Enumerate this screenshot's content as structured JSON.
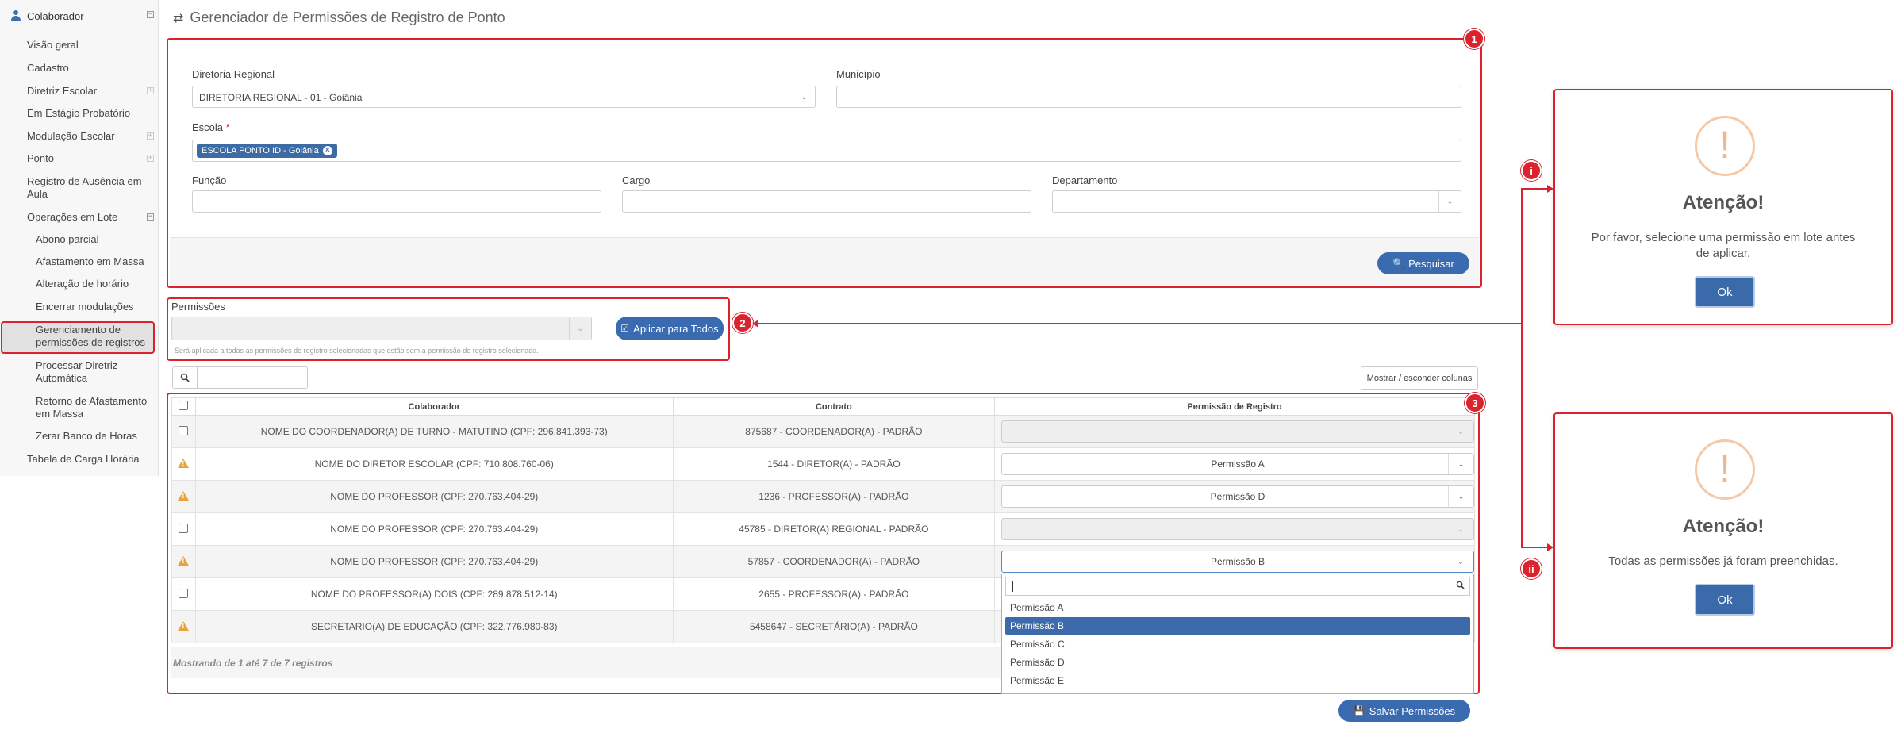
{
  "sidebar": {
    "header": "Colaborador",
    "items": [
      {
        "label": "Visão geral"
      },
      {
        "label": "Cadastro"
      },
      {
        "label": "Diretriz Escolar"
      },
      {
        "label": "Em Estágio Probatório"
      },
      {
        "label": "Modulação Escolar"
      },
      {
        "label": "Ponto"
      },
      {
        "label": "Registro de Ausência em Aula"
      },
      {
        "label": "Operações em Lote"
      }
    ],
    "subitems": [
      {
        "label": "Abono parcial"
      },
      {
        "label": "Afastamento em Massa"
      },
      {
        "label": "Alteração de horário"
      },
      {
        "label": "Encerrar modulações"
      },
      {
        "label": "Gerenciamento de permissões de registros"
      },
      {
        "label": "Processar Diretriz Automática"
      },
      {
        "label": "Retorno de Afastamento em Massa"
      },
      {
        "label": "Zerar Banco de Horas"
      }
    ],
    "last_item": "Tabela de Carga Horária"
  },
  "page": {
    "title": "Gerenciador de Permissões de Registro de Ponto"
  },
  "filters": {
    "diretoria_label": "Diretoria Regional",
    "diretoria_value": "DIRETORIA REGIONAL - 01 - Goiânia",
    "municipio_label": "Município",
    "escola_label": "Escola",
    "escola_required": "*",
    "escola_chip": "ESCOLA PONTO ID - Goiânia",
    "funcao_label": "Função",
    "cargo_label": "Cargo",
    "departamento_label": "Departamento",
    "search_button": "Pesquisar"
  },
  "permissions": {
    "label": "Permissões",
    "apply_button": "Aplicar para Todos",
    "hint": "Será aplicada a todas as permissões de registro selecionadas que estão sem a permissão de registro selecionada."
  },
  "table": {
    "columns_button": "Mostrar / esconder colunas",
    "headers": {
      "colaborador": "Colaborador",
      "contrato": "Contrato",
      "permissao": "Permissão de Registro"
    },
    "rows": [
      {
        "colaborador": "NOME DO COORDENADOR(A) DE TURNO - MATUTINO (CPF: 296.841.393-73)",
        "contrato": "875687 - COORDENADOR(A) - PADRÃO",
        "permissao": ""
      },
      {
        "colaborador": "NOME DO DIRETOR ESCOLAR (CPF: 710.808.760-06)",
        "contrato": "1544 - DIRETOR(A) - PADRÃO",
        "permissao": "Permissão A"
      },
      {
        "colaborador": "NOME DO PROFESSOR (CPF: 270.763.404-29)",
        "contrato": "1236 - PROFESSOR(A) - PADRÃO",
        "permissao": "Permissão D"
      },
      {
        "colaborador": "NOME DO PROFESSOR (CPF: 270.763.404-29)",
        "contrato": "45785 - DIRETOR(A) REGIONAL - PADRÃO",
        "permissao": ""
      },
      {
        "colaborador": "NOME DO PROFESSOR (CPF: 270.763.404-29)",
        "contrato": "57857 - COORDENADOR(A) - PADRÃO",
        "permissao": "Permissão B"
      },
      {
        "colaborador": "NOME DO PROFESSOR(A) DOIS (CPF: 289.878.512-14)",
        "contrato": "2655 - PROFESSOR(A) - PADRÃO",
        "permissao": ""
      },
      {
        "colaborador": "SECRETARIO(A) DE EDUCAÇÃO (CPF: 322.776.980-83)",
        "contrato": "5458647 - SECRETÁRIO(A) - PADRÃO",
        "permissao": ""
      }
    ],
    "showing": "Mostrando de 1 até 7 de 7 registros",
    "dropdown_options": [
      "Permissão A",
      "Permissão B",
      "Permissão C",
      "Permissão D",
      "Permissão E"
    ],
    "save_button": "Salvar Permissões"
  },
  "markers": {
    "m1": "1",
    "m2": "2",
    "m3": "3",
    "mi": "i",
    "mii": "ii"
  },
  "dialogs": [
    {
      "icon": "!",
      "title": "Atenção!",
      "message": "Por favor, selecione uma permissão em lote antes de aplicar.",
      "button": "Ok"
    },
    {
      "icon": "!",
      "title": "Atenção!",
      "message": "Todas as permissões já foram preenchidas.",
      "button": "Ok"
    }
  ],
  "colors": {
    "accent": "#3a6ab0",
    "annotation": "#d9232d",
    "warning": "#e8a33c"
  }
}
